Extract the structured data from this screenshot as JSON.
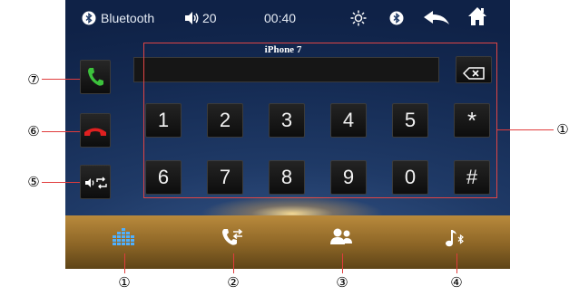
{
  "statusbar": {
    "bluetooth_label": "Bluetooth",
    "volume": "20",
    "time": "00:40",
    "icons": [
      "bluetooth-icon",
      "volume-icon",
      "brightness-icon",
      "bluetooth-icon",
      "back-icon",
      "home-icon"
    ]
  },
  "device_name": "iPhone 7",
  "dial_input": {
    "value": "",
    "backspace_icon": "backspace-icon"
  },
  "keypad": {
    "row1": [
      "1",
      "2",
      "3",
      "4",
      "5",
      "*"
    ],
    "row2": [
      "6",
      "7",
      "8",
      "9",
      "0",
      "#"
    ]
  },
  "side_buttons": [
    "call-icon",
    "hangup-icon",
    "audio-transfer-icon"
  ],
  "bottom_nav": [
    "dialpad-icon",
    "call-log-icon",
    "contacts-icon",
    "bt-music-icon"
  ],
  "callouts": {
    "keypad": "①",
    "call": "⑦",
    "hangup": "⑥",
    "transfer": "⑤",
    "nav1": "①",
    "nav2": "②",
    "nav3": "③",
    "nav4": "④"
  },
  "colors": {
    "screen_bg": "#1f3a67",
    "accent_green": "#3cc23c",
    "accent_red": "#e02020",
    "accent_blue": "#4fb0ff",
    "callout_line": "#e03c3c"
  }
}
